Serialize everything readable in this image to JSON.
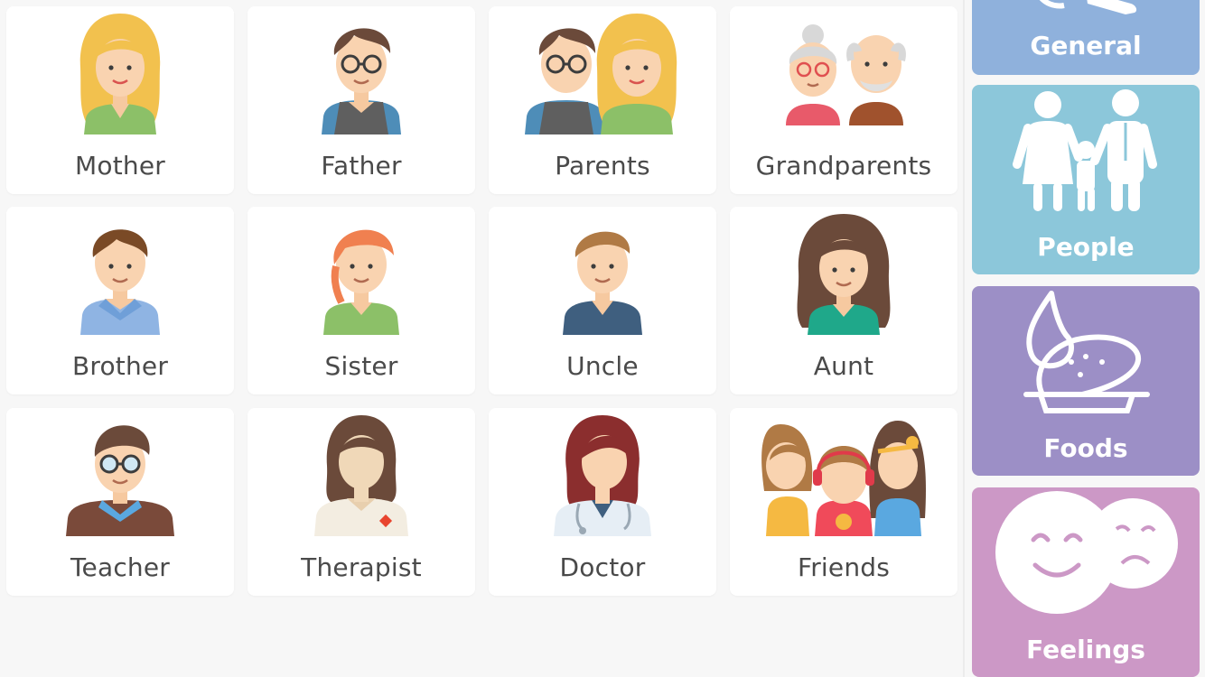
{
  "people_grid": {
    "items": [
      {
        "label": "Mother",
        "icon": "mother-icon"
      },
      {
        "label": "Father",
        "icon": "father-icon"
      },
      {
        "label": "Parents",
        "icon": "parents-icon"
      },
      {
        "label": "Grandparents",
        "icon": "grandparents-icon"
      },
      {
        "label": "Brother",
        "icon": "brother-icon"
      },
      {
        "label": "Sister",
        "icon": "sister-icon"
      },
      {
        "label": "Uncle",
        "icon": "uncle-icon"
      },
      {
        "label": "Aunt",
        "icon": "aunt-icon"
      },
      {
        "label": "Teacher",
        "icon": "teacher-icon"
      },
      {
        "label": "Therapist",
        "icon": "therapist-icon"
      },
      {
        "label": "Doctor",
        "icon": "doctor-icon"
      },
      {
        "label": "Friends",
        "icon": "friends-icon"
      }
    ]
  },
  "categories": {
    "items": [
      {
        "label": "General",
        "color": "#8fb1dc",
        "icon": "general-icon"
      },
      {
        "label": "People",
        "color": "#8cc7da",
        "icon": "family-icon"
      },
      {
        "label": "Foods",
        "color": "#9c8fc6",
        "icon": "food-icon"
      },
      {
        "label": "Feelings",
        "color": "#cc98c6",
        "icon": "feelings-icon"
      }
    ]
  },
  "colors": {
    "background": "#f7f7f7",
    "card": "#ffffff",
    "label_text": "#4a4a4a"
  }
}
